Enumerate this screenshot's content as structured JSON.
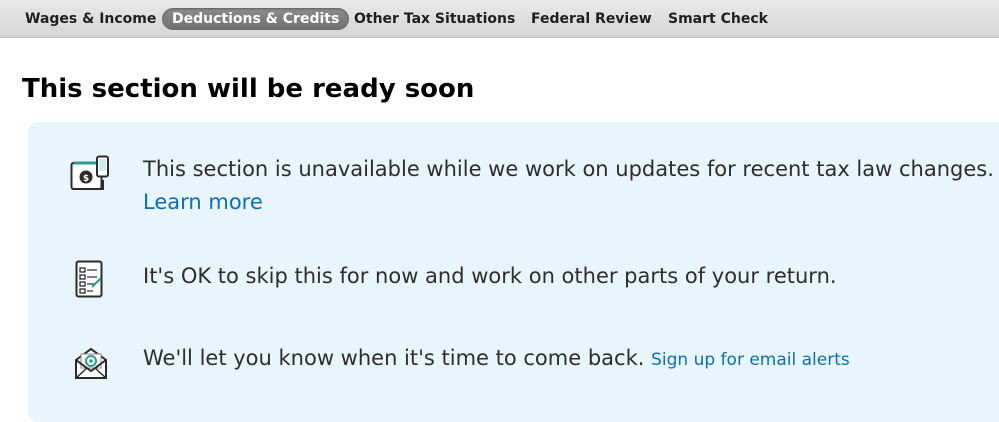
{
  "tabs": [
    {
      "label": "Wages & Income"
    },
    {
      "label": "Deductions & Credits"
    },
    {
      "label": "Other Tax Situations"
    },
    {
      "label": "Federal Review"
    },
    {
      "label": "Smart Check"
    }
  ],
  "active_tab": "Deductions & Credits",
  "page_title": "This section will be ready soon",
  "messages": {
    "unavailable": {
      "text": "This section is unavailable while we work on updates for recent tax law changes.",
      "link": "Learn more",
      "icon": "tax-money-device-icon"
    },
    "skip": {
      "text": "It's OK to skip this for now and work on other parts of your return.",
      "icon": "checklist-icon"
    },
    "notify": {
      "text": "We'll let you know when it's time to come back.",
      "link": "Sign up for email alerts",
      "icon": "email-envelope-icon"
    }
  },
  "colors": {
    "panel_background": "#e9f5fc",
    "link": "#0a6fb4",
    "active_tab": "#7d7d7d",
    "accent_teal": "#2a9d8f"
  }
}
